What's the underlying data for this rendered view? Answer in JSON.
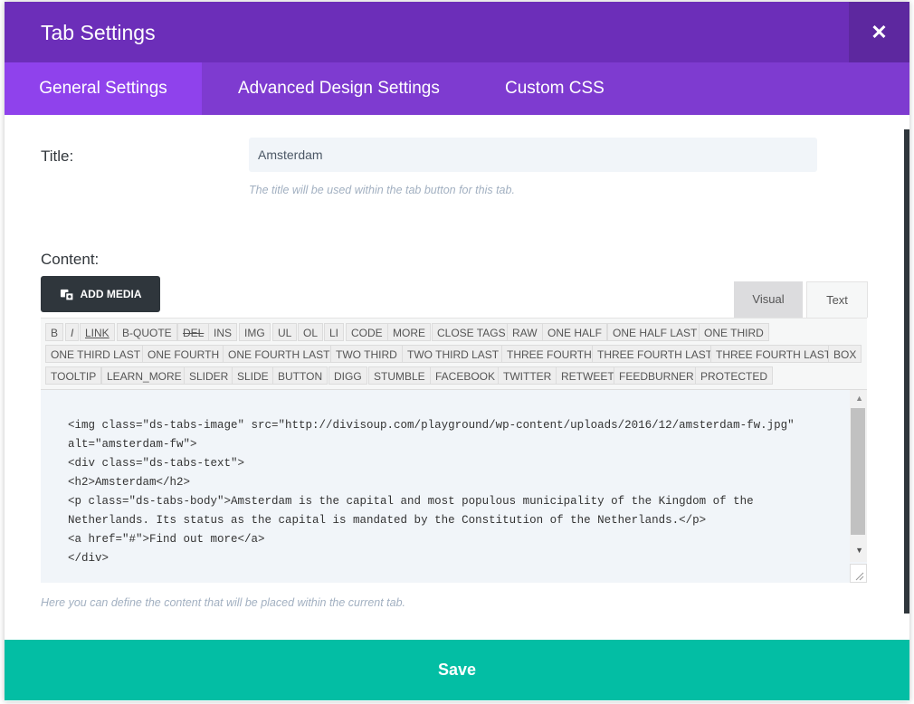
{
  "header": {
    "title": "Tab Settings",
    "close_glyph": "✕"
  },
  "tabs": [
    "General Settings",
    "Advanced Design Settings",
    "Custom CSS"
  ],
  "form": {
    "title_label": "Title:",
    "title_value": "Amsterdam",
    "title_desc": "The title will be used within the tab button for this tab.",
    "content_label": "Content:",
    "add_media_label": "ADD MEDIA",
    "visual_label": "Visual",
    "text_label": "Text",
    "content_desc": "Here you can define the content that will be placed within the current tab."
  },
  "quicktags": [
    [
      "B",
      "I",
      "LINK",
      "B-QUOTE",
      "DEL",
      "INS",
      "IMG",
      "UL",
      "OL",
      "LI",
      "CODE",
      "MORE",
      "CLOSE TAGS",
      "RAW",
      "ONE HALF",
      "ONE HALF LAST",
      "ONE THIRD"
    ],
    [
      "ONE THIRD LAST",
      "ONE FOURTH",
      "ONE FOURTH LAST",
      "TWO THIRD",
      "TWO THIRD LAST",
      "THREE FOURTH",
      "THREE FOURTH LAST",
      "THREE FOURTH LAST",
      "BOX"
    ],
    [
      "TOOLTIP",
      "LEARN_MORE",
      "SLIDER",
      "SLIDE",
      "BUTTON",
      "DIGG",
      "STUMBLE",
      "FACEBOOK",
      "TWITTER",
      "RETWEET",
      "FEEDBURNER",
      "PROTECTED"
    ]
  ],
  "code_lines": [
    "<img class=\"ds-tabs-image\" src=\"http://divisoup.com/playground/wp-content/uploads/2016/12/amsterdam-fw.jpg\"",
    "alt=\"amsterdam-fw\">",
    "<div class=\"ds-tabs-text\">",
    "<h2>Amsterdam</h2>",
    "<p class=\"ds-tabs-body\">Amsterdam is the capital and most populous municipality of the Kingdom of the",
    "Netherlands. Its status as the capital is mandated by the Constitution of the Netherlands.</p>",
    "<a href=\"#\">Find out more</a>",
    "</div>"
  ],
  "save_label": "Save",
  "colors": {
    "header": "#6c2eb9",
    "tabs": "#7e3bd0",
    "active_tab": "#8f42ec",
    "save": "#03bea4"
  }
}
